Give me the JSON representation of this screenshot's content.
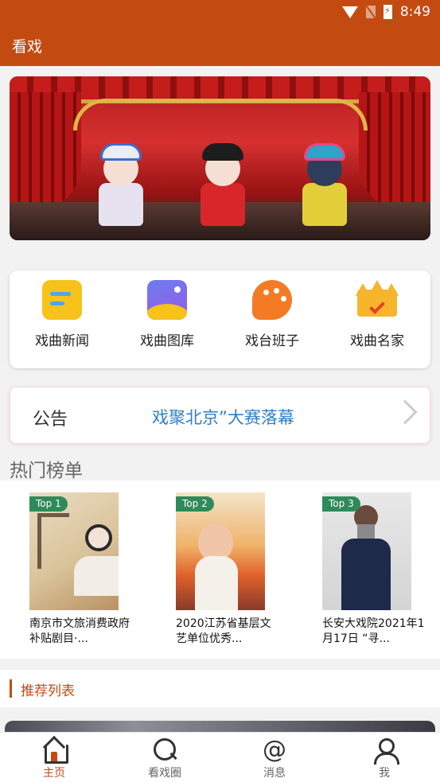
{
  "status_bar": {
    "time": "8:49"
  },
  "app_bar": {
    "title": "看戏"
  },
  "menu": [
    {
      "label": "戏曲新闻",
      "icon": "news-icon"
    },
    {
      "label": "戏曲图库",
      "icon": "gallery-icon"
    },
    {
      "label": "戏台班子",
      "icon": "palette-icon"
    },
    {
      "label": "戏曲名家",
      "icon": "crown-icon"
    }
  ],
  "notice": {
    "label": "公告",
    "text": "戏聚北京”大赛落幕"
  },
  "hot": {
    "title": "热门榜单",
    "items": [
      {
        "badge": "Top 1",
        "caption": "南京市文旅消费政府补贴剧目·..."
      },
      {
        "badge": "Top 2",
        "caption": "2020江苏省基层文艺单位优秀..."
      },
      {
        "badge": "Top 3",
        "caption": "长安大戏院2021年1月17日 “寻..."
      }
    ]
  },
  "recommend": {
    "title": "推荐列表"
  },
  "tabs": [
    {
      "label": "主页",
      "active": true
    },
    {
      "label": "看戏圈",
      "active": false
    },
    {
      "label": "消息",
      "active": false
    },
    {
      "label": "我",
      "active": false
    }
  ],
  "colors": {
    "brand": "#c34b12",
    "notice_text": "#2f7fc8",
    "badge": "#2f8a5a"
  }
}
